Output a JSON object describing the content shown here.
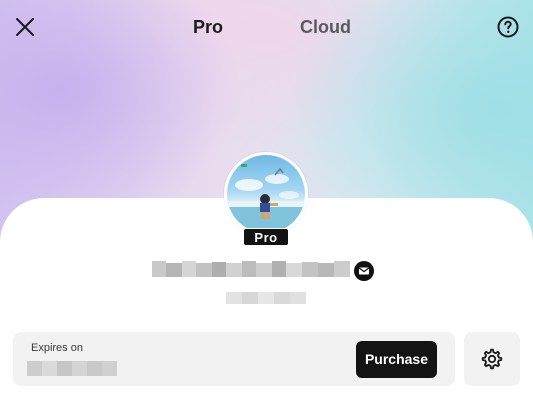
{
  "tabs": [
    {
      "label": "Pro",
      "active": true
    },
    {
      "label": "Cloud",
      "active": false
    }
  ],
  "icons": {
    "close": "close-icon",
    "help": "help-icon",
    "mail": "mail-icon",
    "settings": "gear-icon"
  },
  "profile": {
    "badge": "Pro"
  },
  "subscription": {
    "expires_label": "Expires on",
    "purchase_label": "Purchase"
  },
  "colors": {
    "accent": "#141414",
    "card_bg": "#f2f2f2",
    "tab_active": "#1b1b1b",
    "tab_inactive": "#595a5e"
  }
}
